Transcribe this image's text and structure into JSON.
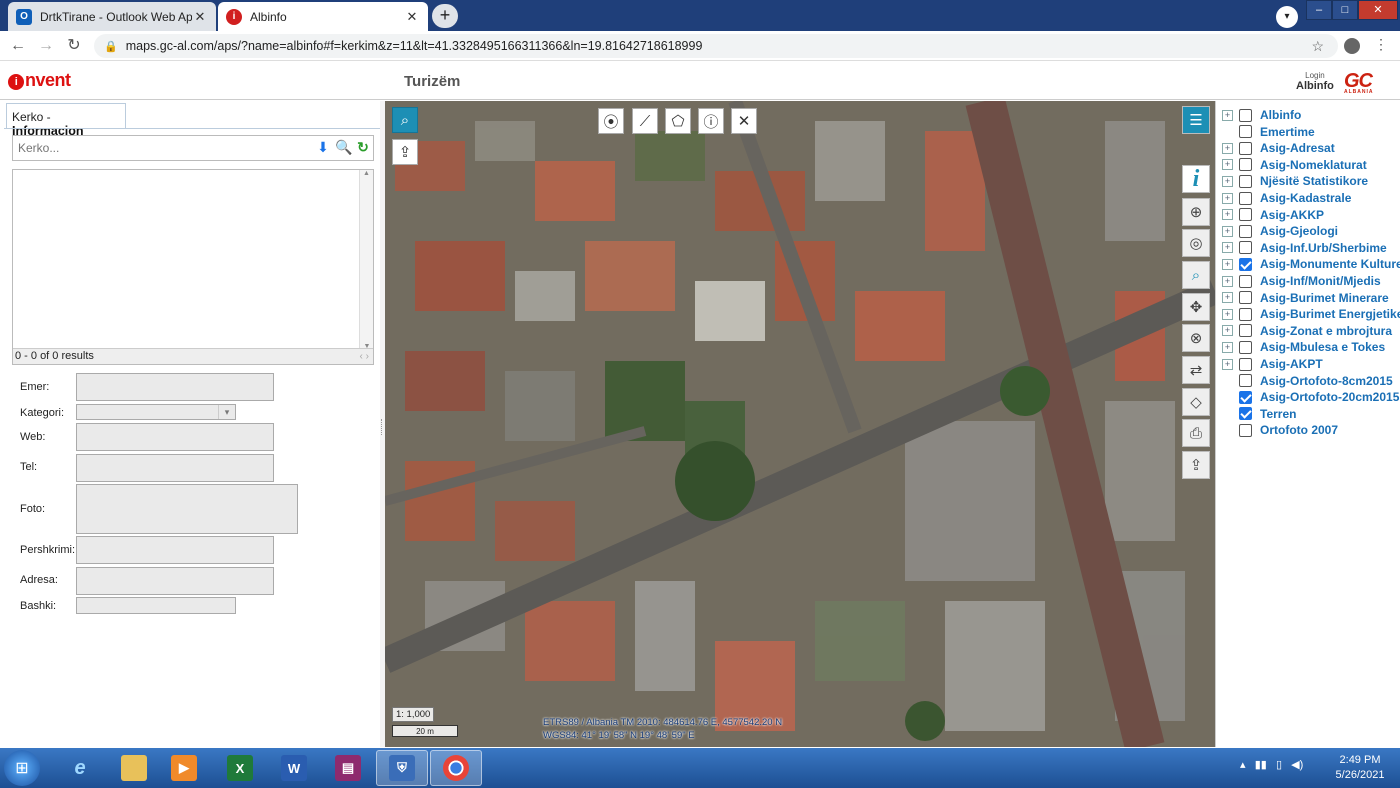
{
  "browser": {
    "tabs": [
      {
        "title": "DrtkTirane - Outlook Web App",
        "icon": "outlook-icon",
        "color": "#0f5fb8"
      },
      {
        "title": "Albinfo",
        "icon": "invent-icon",
        "color": "#d11f1f"
      }
    ],
    "new_tab": "+",
    "url": "maps.gc-al.com/aps/?name=albinfo#f=kerkim&z=11&lt=41.3328495166311366&ln=19.81642718618999"
  },
  "app": {
    "logo_text": "nvent",
    "logo_ring": "i",
    "title": "Turizëm",
    "login_label": "Login",
    "user_label": "Albinfo",
    "gc_logo": "GC",
    "gc_sub": "ALBANIA"
  },
  "left_panel": {
    "tab_prefix": "Kerko -",
    "tab_label": "Informacion",
    "search_placeholder": "Kerko...",
    "results_text": "0 - 0 of 0 results",
    "form": {
      "emer": "Emer:",
      "kategori": "Kategori:",
      "web": "Web:",
      "tel": "Tel:",
      "foto": "Foto:",
      "pershkrimi": "Pershkrimi:",
      "adresa": "Adresa:",
      "bashki": "Bashki:"
    }
  },
  "map": {
    "scale_ratio": "1: 1,000",
    "scale_bar": "20 m",
    "coords_line1": "ETRS89 / Albania TM 2010: 484614.76 E, 4577542.20 N",
    "coords_line2": "WGS84: 41° 19' 58\" N 19° 48' 59\" E"
  },
  "layers": [
    {
      "label": "Albinfo",
      "expandable": true,
      "checked": false
    },
    {
      "label": "Emertime",
      "expandable": false,
      "checked": false
    },
    {
      "label": "Asig-Adresat",
      "expandable": true,
      "checked": false
    },
    {
      "label": "Asig-Nomeklaturat",
      "expandable": true,
      "checked": false
    },
    {
      "label": "Njësitë Statistikore",
      "expandable": true,
      "checked": false
    },
    {
      "label": "Asig-Kadastrale",
      "expandable": true,
      "checked": false
    },
    {
      "label": "Asig-AKKP",
      "expandable": true,
      "checked": false
    },
    {
      "label": "Asig-Gjeologi",
      "expandable": true,
      "checked": false
    },
    {
      "label": "Asig-Inf.Urb/Sherbime",
      "expandable": true,
      "checked": false
    },
    {
      "label": "Asig-Monumente Kulture",
      "expandable": true,
      "checked": true
    },
    {
      "label": "Asig-Inf/Monit/Mjedis",
      "expandable": true,
      "checked": false
    },
    {
      "label": "Asig-Burimet Minerare",
      "expandable": true,
      "checked": false
    },
    {
      "label": "Asig-Burimet Energjetike",
      "expandable": true,
      "checked": false
    },
    {
      "label": "Asig-Zonat e mbrojtura",
      "expandable": true,
      "checked": false
    },
    {
      "label": "Asig-Mbulesa e Tokes",
      "expandable": true,
      "checked": false
    },
    {
      "label": "Asig-AKPT",
      "expandable": true,
      "checked": false
    },
    {
      "label": "Asig-Ortofoto-8cm2015",
      "expandable": false,
      "checked": false
    },
    {
      "label": "Asig-Ortofoto-20cm2015",
      "expandable": false,
      "checked": true
    },
    {
      "label": "Terren",
      "expandable": false,
      "checked": true
    },
    {
      "label": "Ortofoto 2007",
      "expandable": false,
      "checked": false
    }
  ],
  "taskbar": {
    "time": "2:49 PM",
    "date": "5/26/2021"
  },
  "colors": {
    "accent": "#1d8fb5",
    "link": "#1a6fb5",
    "brand_red": "#d11f1f"
  }
}
